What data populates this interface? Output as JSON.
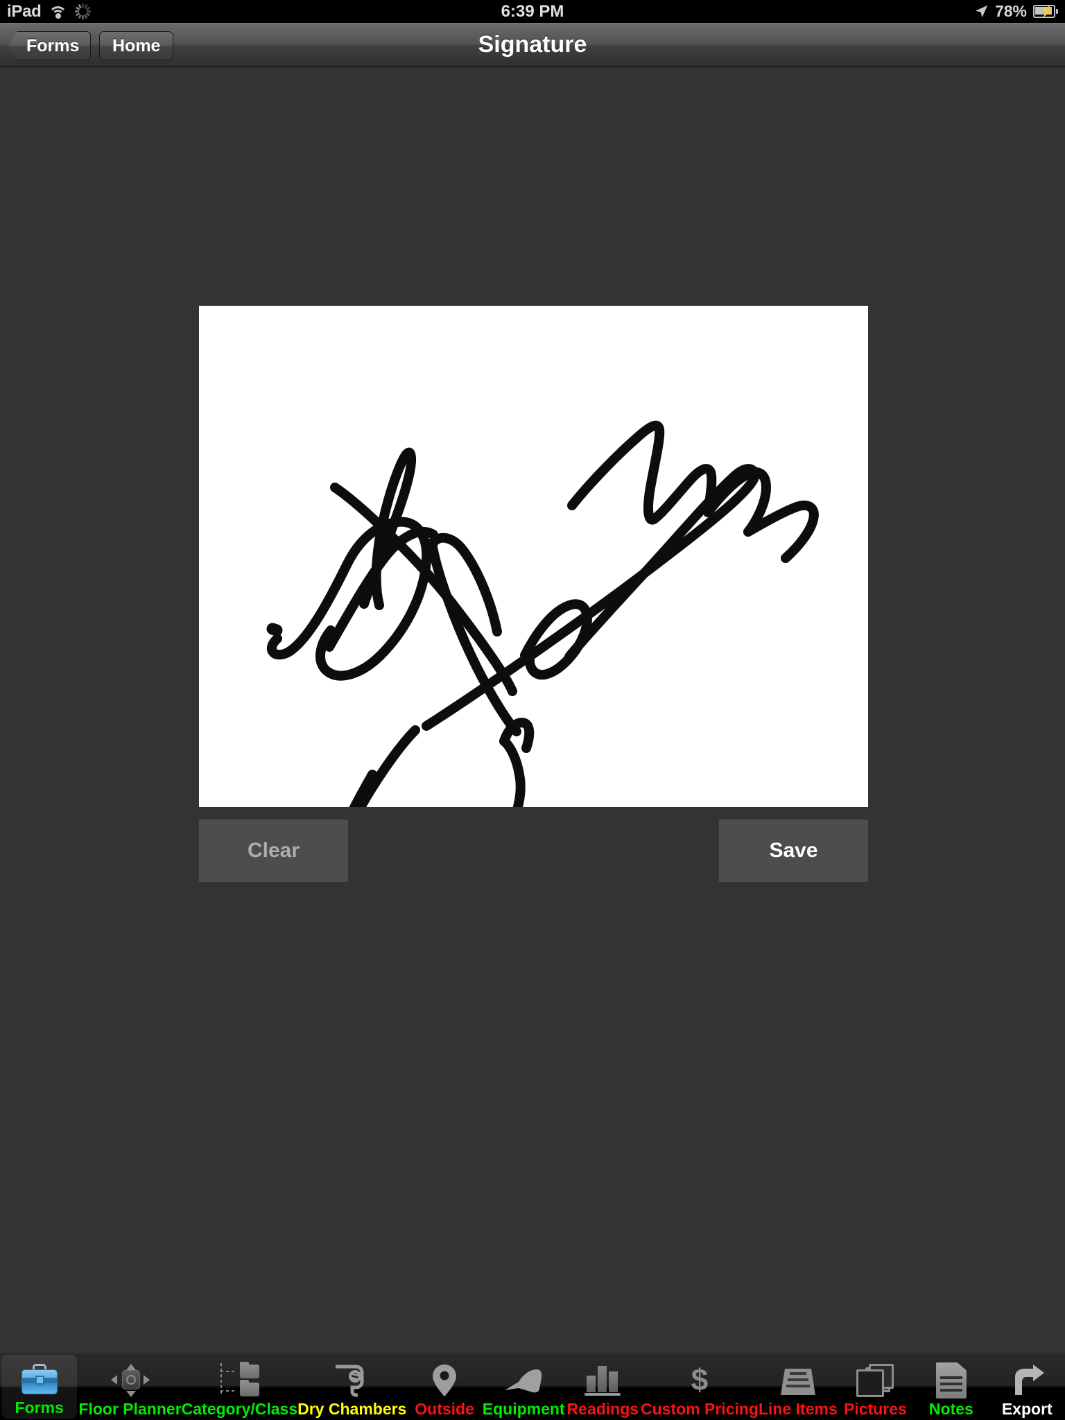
{
  "status_bar": {
    "carrier": "iPad",
    "wifi_icon": "wifi-icon",
    "activity_icon": "spinner-icon",
    "time": "6:39 PM",
    "location_icon": "location-arrow-icon",
    "battery_percent": "78%",
    "battery_icon": "battery-charging-icon"
  },
  "nav_bar": {
    "back_label": "Forms",
    "home_label": "Home",
    "title": "Signature"
  },
  "main": {
    "canvas_name": "signature-drawing-canvas",
    "clear_label": "Clear",
    "save_label": "Save"
  },
  "tab_bar": {
    "items": [
      {
        "label": "Forms",
        "icon": "briefcase-icon",
        "color": "#00ee00",
        "selected": true
      },
      {
        "label": "Floor Planner",
        "icon": "dpad-icon",
        "color": "#00ee00",
        "selected": false
      },
      {
        "label": "Category/Class",
        "icon": "folder-tree-icon",
        "color": "#00ee00",
        "selected": false
      },
      {
        "label": "Dry Chambers",
        "icon": "blower-icon",
        "color": "#ffff00",
        "selected": false
      },
      {
        "label": "Outside",
        "icon": "map-pin-icon",
        "color": "#ff1111",
        "selected": false
      },
      {
        "label": "Equipment",
        "icon": "drill-icon",
        "color": "#00ee00",
        "selected": false
      },
      {
        "label": "Readings",
        "icon": "bar-chart-icon",
        "color": "#ff1111",
        "selected": false
      },
      {
        "label": "Custom Pricing",
        "icon": "dollar-icon",
        "color": "#ff1111",
        "selected": false
      },
      {
        "label": "Line Items",
        "icon": "tray-icon",
        "color": "#ff1111",
        "selected": false
      },
      {
        "label": "Pictures",
        "icon": "photos-icon",
        "color": "#ff1111",
        "selected": false
      },
      {
        "label": "Notes",
        "icon": "document-icon",
        "color": "#00ee00",
        "selected": false
      },
      {
        "label": "Export",
        "icon": "export-arrow-icon",
        "color": "#ffffff",
        "selected": false
      }
    ]
  },
  "colors": {
    "background": "#333333",
    "nav_bar": "#4a4a4a",
    "button": "#4d4d4d",
    "canvas": "#ffffff",
    "ink": "#000000"
  }
}
